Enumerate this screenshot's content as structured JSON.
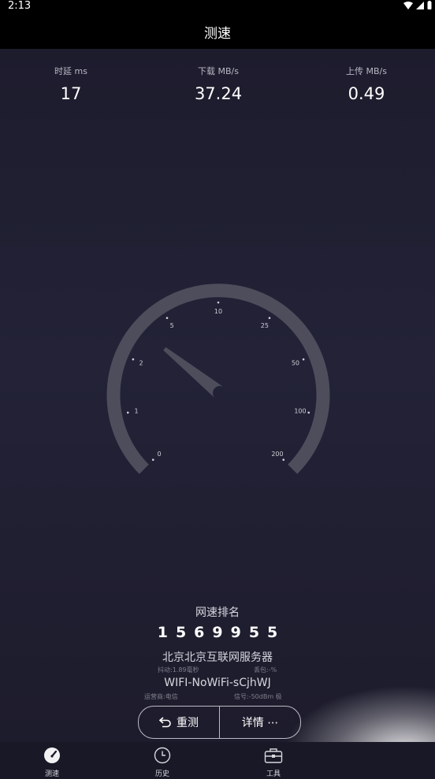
{
  "status_bar": {
    "time": "2:13"
  },
  "header": {
    "title": "测速"
  },
  "metrics": [
    {
      "label": "时延 ms",
      "value": "17"
    },
    {
      "label": "下载 MB/s",
      "value": "37.24"
    },
    {
      "label": "上传 MB/s",
      "value": "0.49"
    }
  ],
  "gauge": {
    "scale_labels": [
      "0",
      "1",
      "2",
      "5",
      "10",
      "25",
      "50",
      "100",
      "200"
    ],
    "current_value_mb_s": 37.24,
    "needle_scale_position": 0.31
  },
  "ranking": {
    "title": "网速排名",
    "number": "1569955"
  },
  "server": {
    "name": "北京北京互联网服务器",
    "jitter": "抖动:1.89毫秒",
    "packet_loss": "丢包:-%"
  },
  "network": {
    "wifi_name": "WIFI-NoWiFi-sCjhWJ",
    "carrier": "运营商:电信",
    "signal": "信号:-50dBm 极"
  },
  "actions": {
    "retest_label": "重测",
    "details_label": "详情 ⋯"
  },
  "nav": {
    "items": [
      {
        "label": "测速",
        "icon": "speedometer-icon"
      },
      {
        "label": "历史",
        "icon": "clock-icon"
      },
      {
        "label": "工具",
        "icon": "toolbox-icon"
      }
    ]
  }
}
